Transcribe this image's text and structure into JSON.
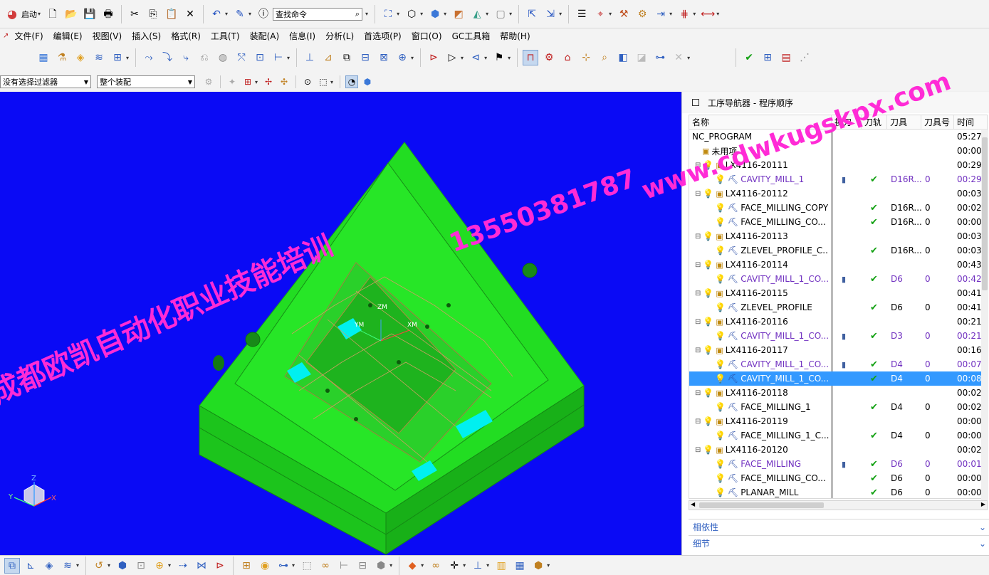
{
  "toolbar1": {
    "start_label": "启动",
    "search_placeholder": "查找命令"
  },
  "menu": [
    "文件(F)",
    "编辑(E)",
    "视图(V)",
    "插入(S)",
    "格式(R)",
    "工具(T)",
    "装配(A)",
    "信息(I)",
    "分析(L)",
    "首选项(P)",
    "窗口(O)",
    "GC工具箱",
    "帮助(H)"
  ],
  "selection_bar": {
    "filter_value": "没有选择过滤器",
    "scope_value": "整个装配"
  },
  "navigator": {
    "title": "工序导航器 - 程序顺序",
    "columns": [
      "名称",
      "换刀",
      "刀轨",
      "刀具",
      "刀具号",
      "时间"
    ],
    "rows": [
      {
        "name": "NC_PROGRAM",
        "type": "root",
        "time": "05:27"
      },
      {
        "name": "未用项",
        "type": "folder",
        "time": "00:00"
      },
      {
        "name": "LX4116-20111",
        "type": "group",
        "time": "00:29"
      },
      {
        "name": "CAVITY_MILL_1",
        "type": "op",
        "purple": true,
        "change": true,
        "path": true,
        "tool": "D16R...",
        "tool_no": "0",
        "time": "00:29"
      },
      {
        "name": "LX4116-20112",
        "type": "group",
        "time": "00:03"
      },
      {
        "name": "FACE_MILLING_COPY",
        "type": "op",
        "path": true,
        "tool": "D16R...",
        "tool_no": "0",
        "time": "00:02"
      },
      {
        "name": "FACE_MILLING_CO...",
        "type": "op",
        "path": true,
        "tool": "D16R...",
        "tool_no": "0",
        "time": "00:00"
      },
      {
        "name": "LX4116-20113",
        "type": "group",
        "time": "00:03"
      },
      {
        "name": "ZLEVEL_PROFILE_C...",
        "type": "op",
        "path": true,
        "tool": "D16R...",
        "tool_no": "0",
        "time": "00:03"
      },
      {
        "name": "LX4116-20114",
        "type": "group",
        "time": "00:43"
      },
      {
        "name": "CAVITY_MILL_1_CO...",
        "type": "op",
        "purple": true,
        "change": true,
        "path": true,
        "tool": "D6",
        "tool_no": "0",
        "time": "00:42"
      },
      {
        "name": "LX4116-20115",
        "type": "group",
        "time": "00:41"
      },
      {
        "name": "ZLEVEL_PROFILE",
        "type": "op",
        "path": true,
        "tool": "D6",
        "tool_no": "0",
        "time": "00:41"
      },
      {
        "name": "LX4116-20116",
        "type": "group",
        "time": "00:21"
      },
      {
        "name": "CAVITY_MILL_1_CO...",
        "type": "op",
        "purple": true,
        "change": true,
        "path": true,
        "tool": "D3",
        "tool_no": "0",
        "time": "00:21"
      },
      {
        "name": "LX4116-20117",
        "type": "group",
        "time": "00:16"
      },
      {
        "name": "CAVITY_MILL_1_CO...",
        "type": "op",
        "purple": true,
        "change": true,
        "path": true,
        "tool": "D4",
        "tool_no": "0",
        "time": "00:07"
      },
      {
        "name": "CAVITY_MILL_1_CO...",
        "type": "op",
        "selected": true,
        "path": true,
        "tool": "D4",
        "tool_no": "0",
        "time": "00:08"
      },
      {
        "name": "LX4116-20118",
        "type": "group",
        "time": "00:02"
      },
      {
        "name": "FACE_MILLING_1",
        "type": "op",
        "path": true,
        "tool": "D4",
        "tool_no": "0",
        "time": "00:02"
      },
      {
        "name": "LX4116-20119",
        "type": "group",
        "time": "00:00"
      },
      {
        "name": "FACE_MILLING_1_C...",
        "type": "op",
        "path": true,
        "tool": "D4",
        "tool_no": "0",
        "time": "00:00"
      },
      {
        "name": "LX4116-20120",
        "type": "group",
        "time": "00:02"
      },
      {
        "name": "FACE_MILLING",
        "type": "op",
        "purple": true,
        "change": true,
        "path": true,
        "tool": "D6",
        "tool_no": "0",
        "time": "00:01"
      },
      {
        "name": "FACE_MILLING_CO...",
        "type": "op",
        "path": true,
        "tool": "D6",
        "tool_no": "0",
        "time": "00:00"
      },
      {
        "name": "PLANAR_MILL",
        "type": "op",
        "path": true,
        "tool": "D6",
        "tool_no": "0",
        "time": "00:00"
      }
    ],
    "panels": [
      "相依性",
      "细节"
    ]
  },
  "graphics": {
    "background_color": "#0a0af5",
    "part_color": "#22dd22",
    "axis_labels": {
      "x": "X",
      "y": "Y",
      "z": "Z"
    },
    "wcs_labels": {
      "zm": "ZM",
      "xm": "XM",
      "ym": "YM"
    }
  },
  "watermarks": {
    "company": "成都欧凯自动化职业技能培训",
    "phone": "13550381787",
    "site": "www.cdwkugskpx.com"
  }
}
